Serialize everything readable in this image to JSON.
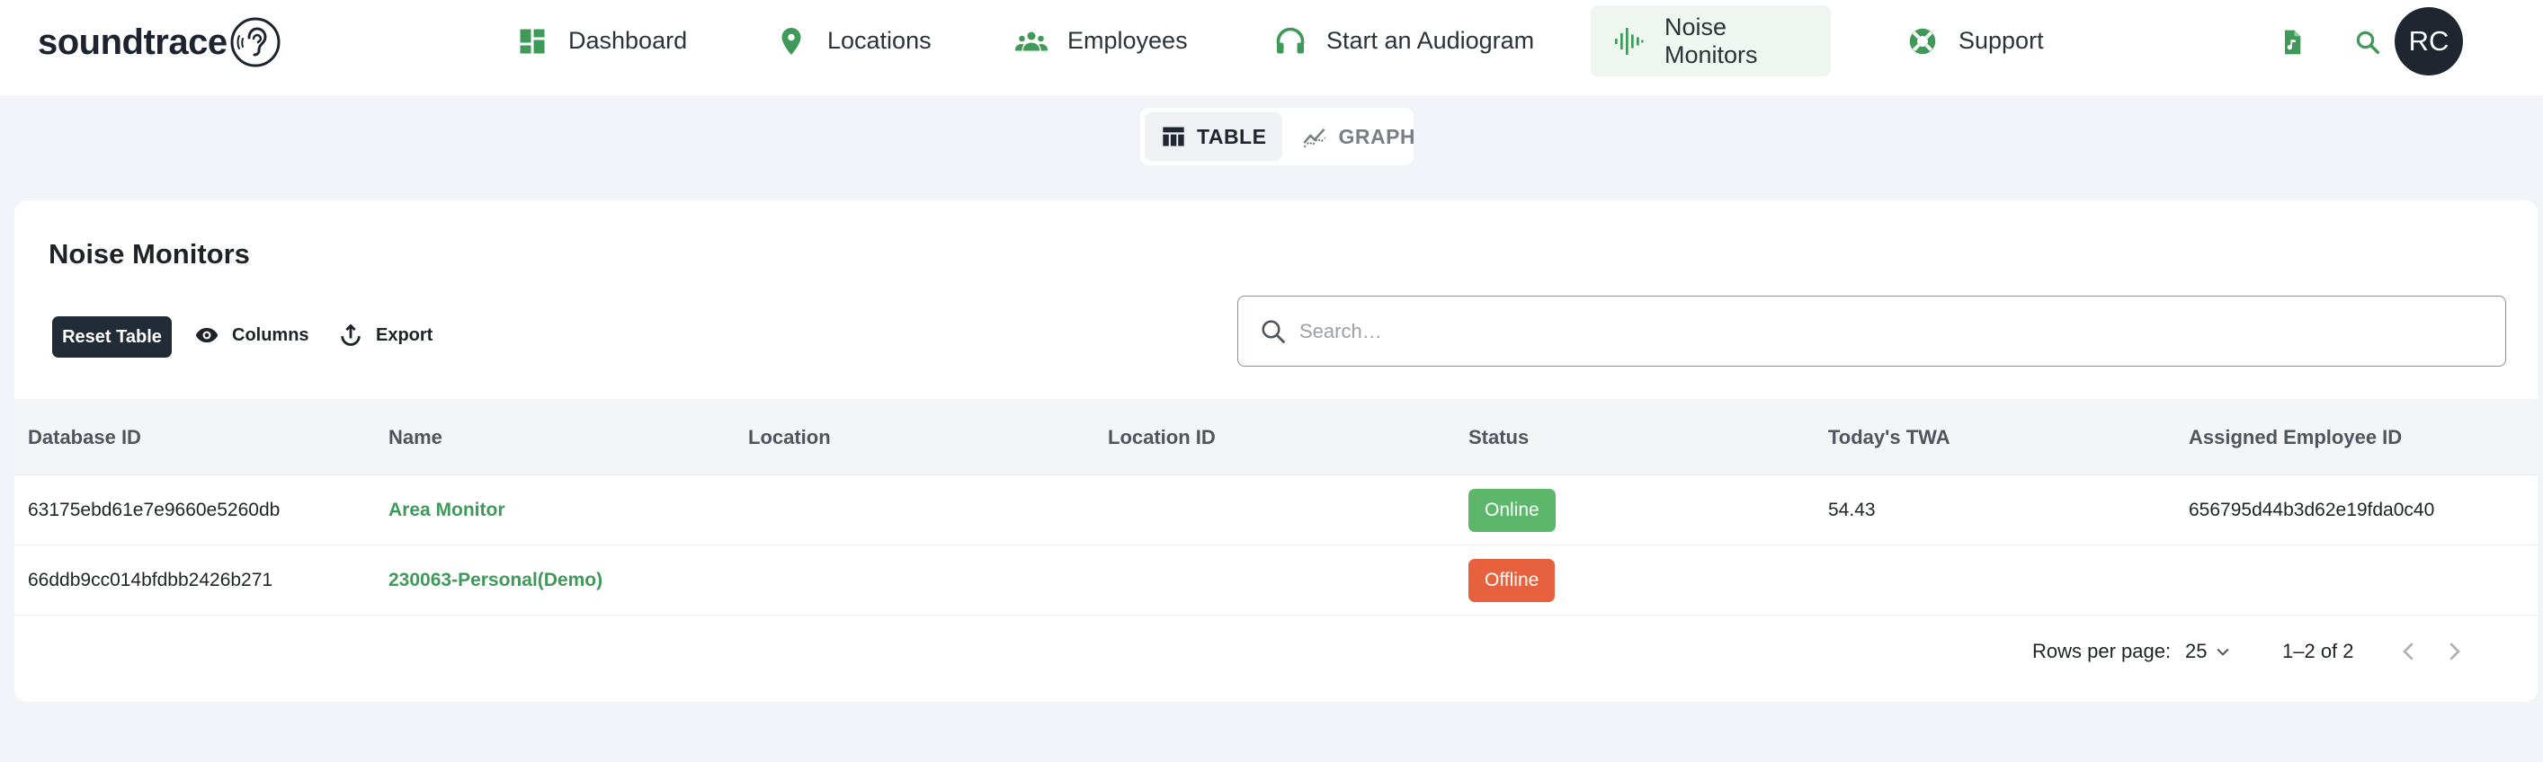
{
  "app": {
    "logo_text": "soundtrace",
    "user_initials": "RC"
  },
  "nav": {
    "items": [
      {
        "label": "Dashboard",
        "icon": "dashboard-icon"
      },
      {
        "label": "Locations",
        "icon": "location-pin-icon"
      },
      {
        "label": "Employees",
        "icon": "people-icon"
      },
      {
        "label": "Start an Audiogram",
        "icon": "headphones-icon"
      },
      {
        "label": "Noise Monitors",
        "icon": "sound-wave-icon",
        "active": true
      },
      {
        "label": "Support",
        "icon": "lifebuoy-icon"
      }
    ]
  },
  "view_toggle": {
    "table_label": "TABLE",
    "graph_label": "GRAPH",
    "active": "TABLE"
  },
  "card": {
    "title": "Noise Monitors",
    "reset_label": "Reset Table",
    "columns_label": "Columns",
    "export_label": "Export",
    "search_placeholder": "Search…"
  },
  "table": {
    "columns": [
      "Database ID",
      "Name",
      "Location",
      "Location ID",
      "Status",
      "Today's TWA",
      "Assigned Employee ID"
    ],
    "rows": [
      {
        "database_id": "63175ebd61e7e9660e5260db",
        "name": "Area Monitor",
        "location": "",
        "location_id": "",
        "status": "Online",
        "twa": "54.43",
        "employee_id": "656795d44b3d62e19fda0c40"
      },
      {
        "database_id": "66ddb9cc014bfdbb2426b271",
        "name": "230063-Personal(Demo)",
        "location": "",
        "location_id": "",
        "status": "Offline",
        "twa": "",
        "employee_id": ""
      }
    ]
  },
  "pagination": {
    "rows_per_page_label": "Rows per page:",
    "rows_per_page": "25",
    "range": "1–2 of 2"
  },
  "colors": {
    "accent_green": "#3f9a5a",
    "online": "#5cb76a",
    "offline": "#e8613e",
    "dark": "#232b36"
  }
}
